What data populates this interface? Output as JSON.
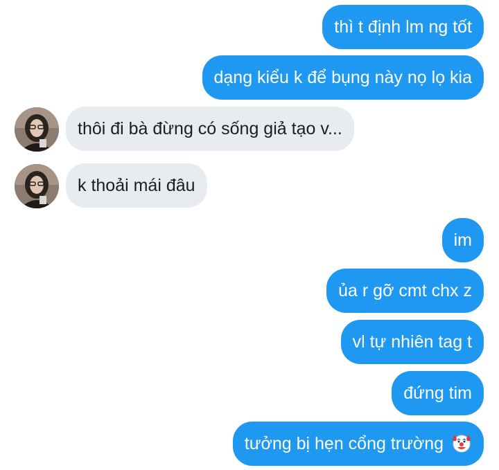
{
  "messages": [
    {
      "side": "out",
      "text": "thì t định lm ng tốt"
    },
    {
      "side": "out",
      "text": "dạng kiểu k để bụng này nọ lọ kia"
    },
    {
      "side": "in",
      "text": "thôi đi bà đừng có sống giả tạo v..."
    },
    {
      "side": "in",
      "text": "k thoải mái đâu"
    },
    {
      "side": "out",
      "text": "im"
    },
    {
      "side": "out",
      "text": "ủa r gỡ cmt chx z"
    },
    {
      "side": "out",
      "text": "vl tự nhiên tag t"
    },
    {
      "side": "out",
      "text": "đứng tim"
    },
    {
      "side": "out",
      "text": "tưởng bị hẹn cổng trường",
      "emoji": "clown-face-emoji"
    }
  ],
  "colors": {
    "outgoing_bubble": "#1e98f0",
    "incoming_bubble": "#e8ebef",
    "background": "#ffffff"
  }
}
